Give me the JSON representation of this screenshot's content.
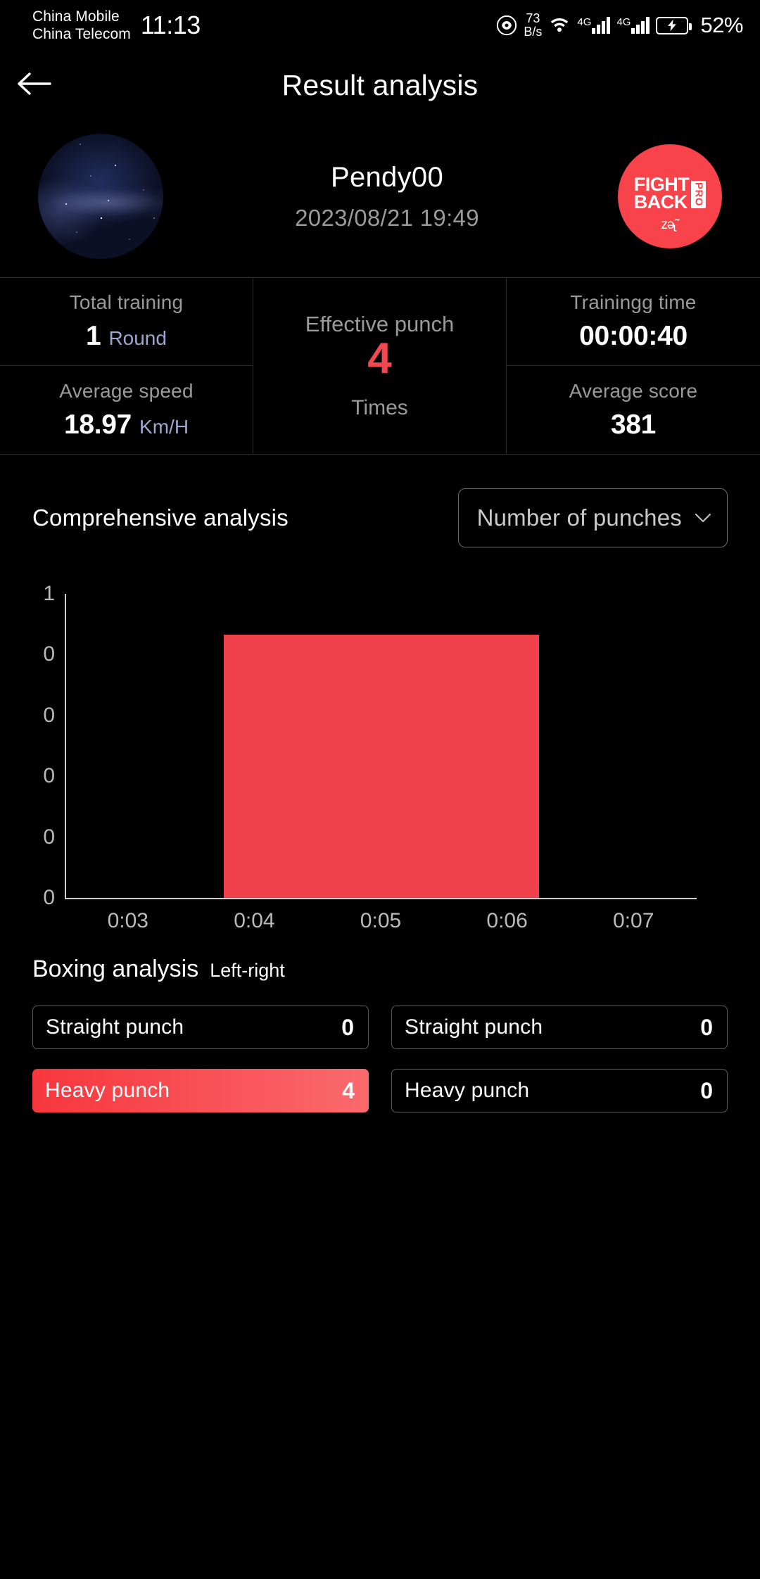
{
  "statusbar": {
    "carrier_line1": "China Mobile",
    "carrier_line2": "China Telecom",
    "time": "11:13",
    "eye_icon": "eye-icon",
    "net_speed_value": "73",
    "net_speed_unit": "B/s",
    "wifi_icon": "wifi-icon",
    "sim1_net": "4G",
    "sim2_net": "4G",
    "battery_icon": "battery-charging-icon",
    "battery_percent": "52%"
  },
  "appbar": {
    "back_icon": "back-arrow-icon",
    "title": "Result analysis"
  },
  "profile": {
    "avatar_alt": "avatar-image",
    "username": "Pendy00",
    "datetime": "2023/08/21 19:49",
    "logo": {
      "line1": "FIGHT",
      "line2": "BACK",
      "badge": "PRO",
      "squiggle": "ᴢᶕ˜"
    }
  },
  "stats": {
    "total_training": {
      "label": "Total training",
      "value": "1",
      "unit": "Round"
    },
    "effective_punch": {
      "label": "Effective punch",
      "value": "4",
      "unit": "Times"
    },
    "training_time": {
      "label": "Trainingg time",
      "value": "00:00:40",
      "unit": ""
    },
    "average_speed": {
      "label": "Average speed",
      "value": "18.97",
      "unit": "Km/H"
    },
    "average_score": {
      "label": "Average score",
      "value": "381",
      "unit": ""
    }
  },
  "comprehensive": {
    "title": "Comprehensive analysis",
    "dropdown_value": "Number of punches",
    "dropdown_icon": "chevron-down-icon"
  },
  "chart_data": {
    "type": "bar",
    "title": "Comprehensive analysis",
    "xlabel": "",
    "ylabel": "",
    "categories": [
      "0:03",
      "0:04",
      "0:05",
      "0:06",
      "0:07"
    ],
    "x_tick_labels": [
      "0:03",
      "0:04",
      "0:05",
      "0:06",
      "0:07"
    ],
    "y_tick_labels": [
      "1",
      "0",
      "0",
      "0",
      "0",
      "0"
    ],
    "y_tick_values": [
      1,
      0.8,
      0.6,
      0.4,
      0.2,
      0
    ],
    "ylim": [
      0,
      1.15
    ],
    "values": [
      0,
      1,
      1,
      1,
      0
    ],
    "bars": [
      {
        "x_start": "0:03.8",
        "x_end": "0:06.2",
        "value": 1
      }
    ],
    "series": [
      {
        "name": "Number of punches",
        "values": [
          0,
          1,
          1,
          1,
          0
        ]
      }
    ],
    "grid": false,
    "legend": "none",
    "bar_color": "#f04049"
  },
  "boxing": {
    "title": "Boxing analysis",
    "subtitle": "Left-right",
    "left_column": [
      {
        "label": "Straight punch",
        "value": "0",
        "highlighted": false
      },
      {
        "label": "Heavy punch",
        "value": "4",
        "highlighted": true
      }
    ],
    "right_column": [
      {
        "label": "Straight punch",
        "value": "0",
        "highlighted": false
      },
      {
        "label": "Heavy punch",
        "value": "0",
        "highlighted": false
      }
    ]
  },
  "colors": {
    "accent_red": "#f8434a",
    "bar_red": "#f04049",
    "unit_blue": "#9ea7d0",
    "muted_gray": "#9a9a9a",
    "background": "#000000"
  }
}
